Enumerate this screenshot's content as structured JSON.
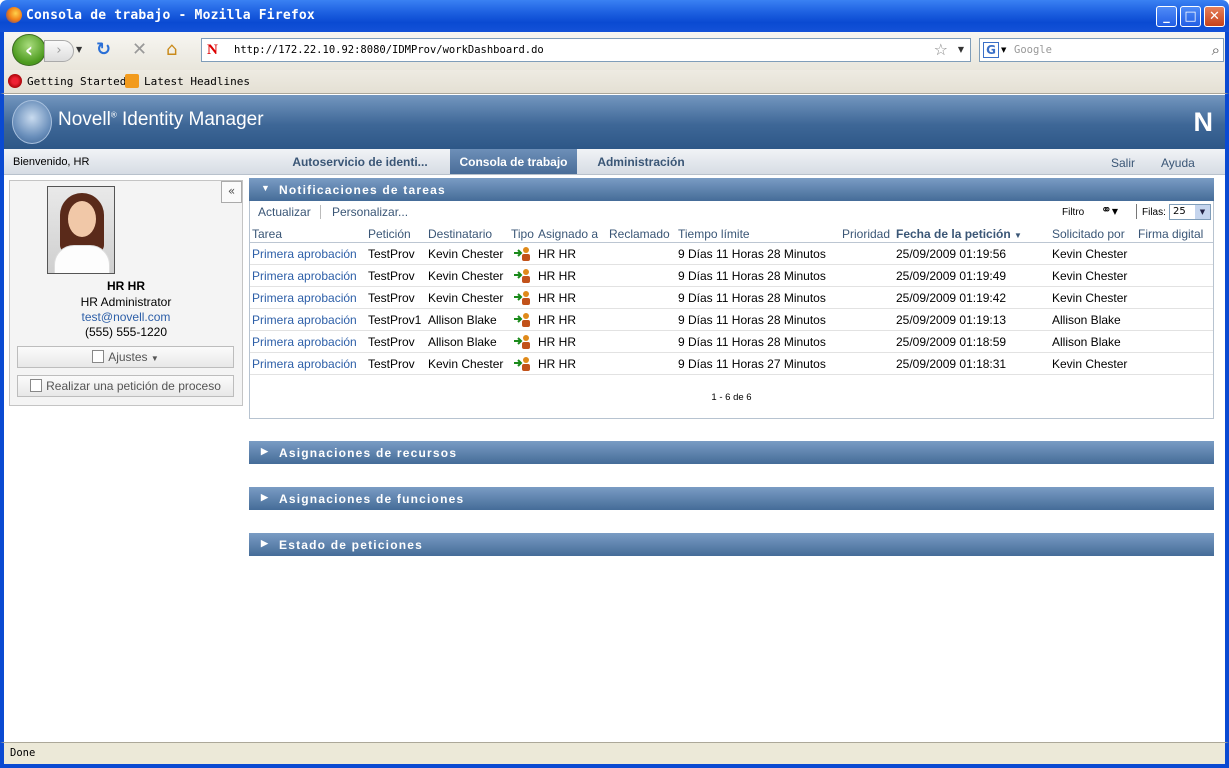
{
  "window": {
    "title": "Consola de trabajo - Mozilla Firefox",
    "minimize": "_",
    "maximize": "□",
    "close": "✕"
  },
  "browser": {
    "url": "http://172.22.10.92:8080/IDMProv/workDashboard.do",
    "search_placeholder": "Google",
    "bookmarks": [
      "Getting Started",
      "Latest Headlines"
    ],
    "status": "Done"
  },
  "app": {
    "brand_name": "Novell",
    "brand_reg": "®",
    "brand_product": "Identity Manager",
    "brand_mark": "N",
    "welcome": "Bienvenido, HR",
    "tabs": [
      {
        "label": "Autoservicio de identi..."
      },
      {
        "label": "Consola de trabajo"
      },
      {
        "label": "Administración"
      }
    ],
    "top_links": {
      "logout": "Salir",
      "help": "Ayuda"
    }
  },
  "profile": {
    "name": "HR HR",
    "title": "HR Administrator",
    "email": "test@novell.com",
    "phone": "(555) 555-1220",
    "settings_button": "Ajustes",
    "process_request_button": "Realizar una petición de proceso",
    "collapse": "«"
  },
  "tasks": {
    "heading": "Notificaciones de tareas",
    "refresh": "Actualizar",
    "customize": "Personalizar...",
    "filter_label": "Filtro",
    "rows_label": "Filas:",
    "rows_value": "25",
    "columns": [
      "Tarea",
      "Petición",
      "Destinatario",
      "Tipo",
      "Asignado a",
      "Reclamado",
      "Tiempo límite",
      "Prioridad",
      "Fecha de la petición",
      "Solicitado por",
      "Firma digital"
    ],
    "sort_indicator": "▼",
    "rows": [
      {
        "task": "Primera aprobación",
        "request": "TestProv",
        "recipient": "Kevin Chester",
        "assigned": "HR HR",
        "deadline": "9 Días 11 Horas 28 Minutos",
        "date": "25/09/2009 01:19:56",
        "requested_by": "Kevin Chester"
      },
      {
        "task": "Primera aprobación",
        "request": "TestProv",
        "recipient": "Kevin Chester",
        "assigned": "HR HR",
        "deadline": "9 Días 11 Horas 28 Minutos",
        "date": "25/09/2009 01:19:49",
        "requested_by": "Kevin Chester"
      },
      {
        "task": "Primera aprobación",
        "request": "TestProv",
        "recipient": "Kevin Chester",
        "assigned": "HR HR",
        "deadline": "9 Días 11 Horas 28 Minutos",
        "date": "25/09/2009 01:19:42",
        "requested_by": "Kevin Chester"
      },
      {
        "task": "Primera aprobación",
        "request": "TestProv1",
        "recipient": "Allison Blake",
        "assigned": "HR HR",
        "deadline": "9 Días 11 Horas 28 Minutos",
        "date": "25/09/2009 01:19:13",
        "requested_by": "Allison Blake"
      },
      {
        "task": "Primera aprobación",
        "request": "TestProv",
        "recipient": "Allison Blake",
        "assigned": "HR HR",
        "deadline": "9 Días 11 Horas 28 Minutos",
        "date": "25/09/2009 01:18:59",
        "requested_by": "Allison Blake"
      },
      {
        "task": "Primera aprobación",
        "request": "TestProv",
        "recipient": "Kevin Chester",
        "assigned": "HR HR",
        "deadline": "9 Días 11 Horas 27 Minutos",
        "date": "25/09/2009 01:18:31",
        "requested_by": "Kevin Chester"
      }
    ],
    "pager": "1 - 6 de 6"
  },
  "sections": {
    "resources": "Asignaciones de recursos",
    "roles": "Asignaciones de funciones",
    "request_status": "Estado de peticiones"
  },
  "icons": {
    "expanded": "▼",
    "collapsed": "▶"
  }
}
